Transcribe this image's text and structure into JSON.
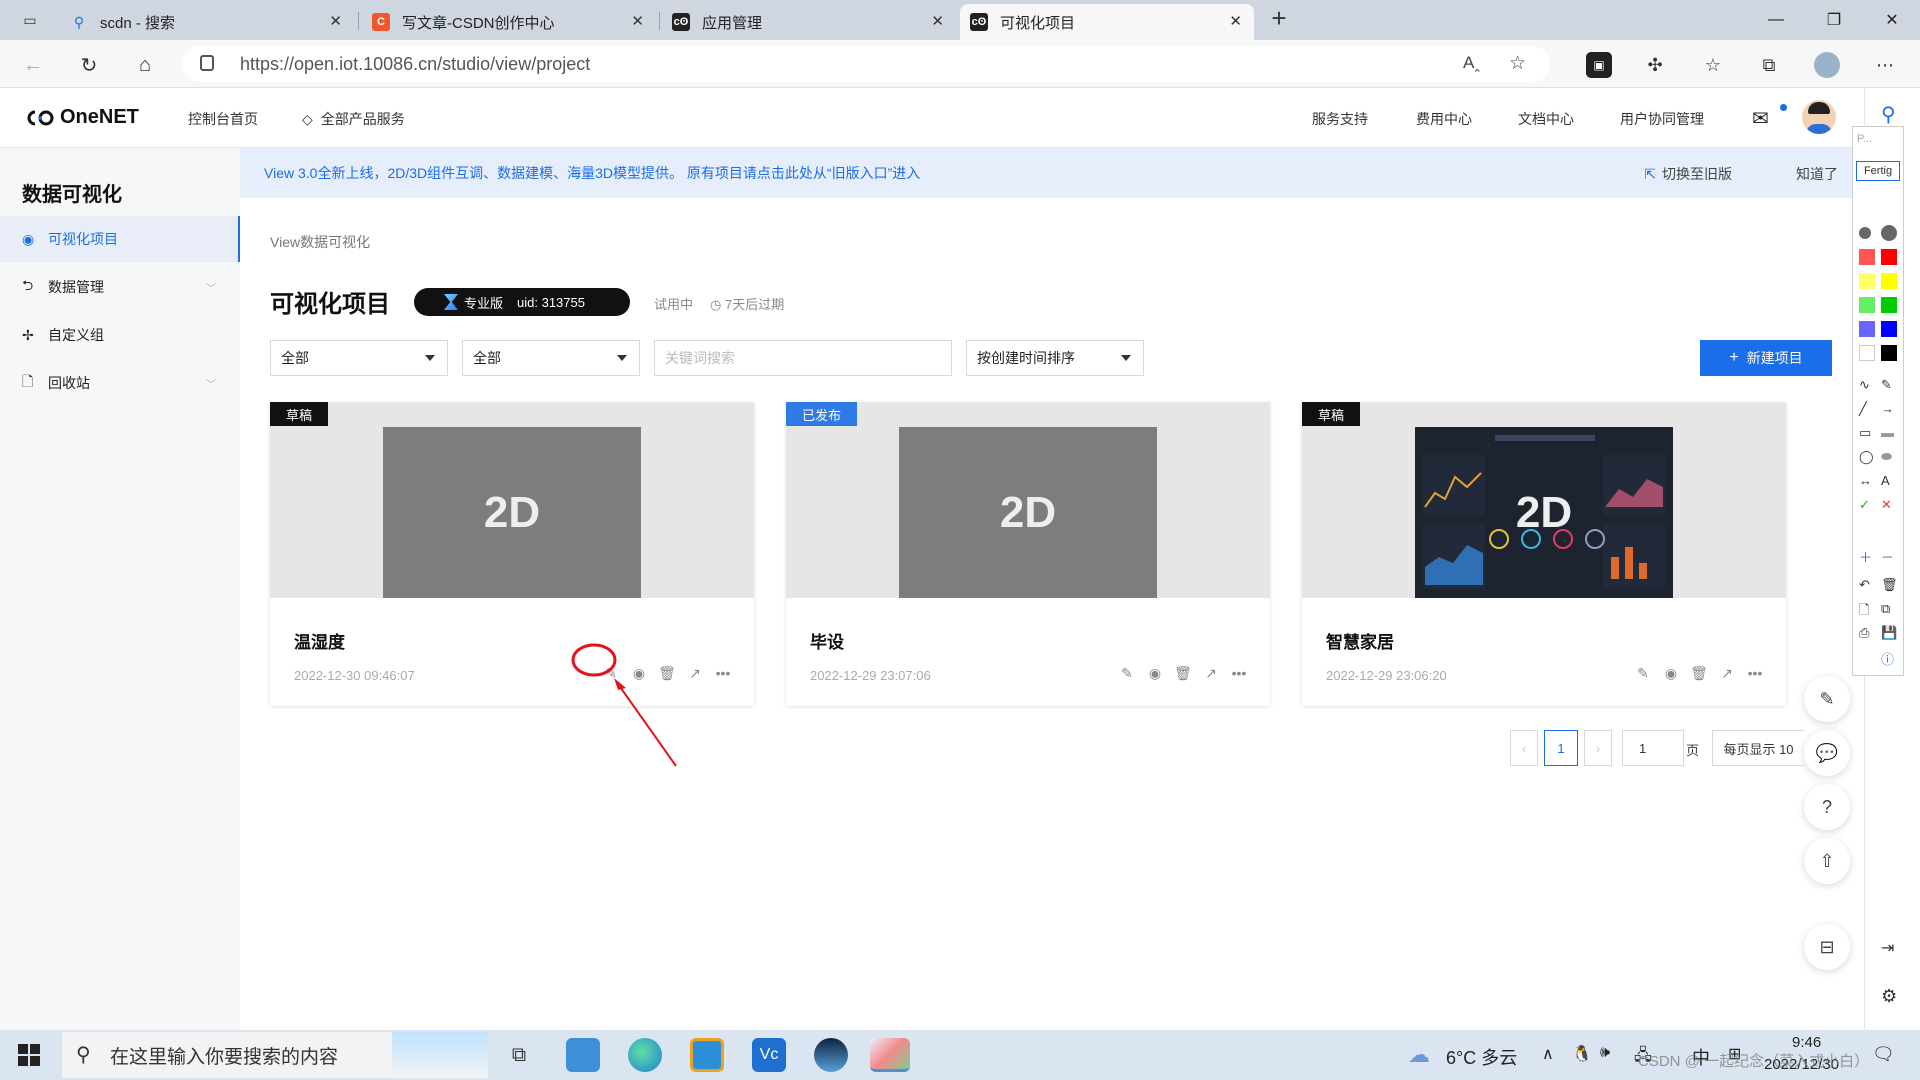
{
  "browser": {
    "tabs": [
      {
        "title": "scdn - 搜索",
        "icon": "search-icon"
      },
      {
        "title": "写文章-CSDN创作中心",
        "icon": "csdn-icon"
      },
      {
        "title": "应用管理",
        "icon": "onenet-icon"
      },
      {
        "title": "可视化项目",
        "icon": "onenet-icon"
      }
    ],
    "url": "https://open.iot.10086.cn/studio/view/project"
  },
  "header": {
    "logo": "OneNET",
    "nav_console": "控制台首页",
    "nav_products": "全部产品服务",
    "nav_support": "服务支持",
    "nav_billing": "费用中心",
    "nav_docs": "文档中心",
    "nav_users": "用户协同管理"
  },
  "sidebar": {
    "title": "数据可视化",
    "items": [
      {
        "label": "可视化项目",
        "icon": "dashboard-icon"
      },
      {
        "label": "数据管理",
        "icon": "data-icon"
      },
      {
        "label": "自定义组",
        "icon": "group-icon"
      },
      {
        "label": "回收站",
        "icon": "trash-icon"
      }
    ]
  },
  "notice": {
    "text": "View 3.0全新上线，2D/3D组件互调、数据建模、海量3D模型提供。 原有项目请点击此处从“旧版入口”进入",
    "switch_label": "切换至旧版",
    "dismiss_label": "知道了"
  },
  "main": {
    "breadcrumb": "View数据可视化",
    "title": "可视化项目",
    "edition": "专业版",
    "uid": "uid: 313755",
    "trial": "试用中",
    "expire": "7天后过期",
    "filter1": "全部",
    "filter2": "全部",
    "search_placeholder": "关键词搜索",
    "sort": "按创建时间排序",
    "new_button": "新建项目"
  },
  "cards": [
    {
      "name": "温湿度",
      "time": "2022-12-30 09:46:07",
      "badge": "草稿",
      "badge_color": "#111111",
      "preview": "2D"
    },
    {
      "name": "毕设",
      "time": "2022-12-29 23:07:06",
      "badge": "已发布",
      "badge_color": "#2f7ae5",
      "preview": "2D"
    },
    {
      "name": "智慧家居",
      "time": "2022-12-29 23:06:20",
      "badge": "草稿",
      "badge_color": "#111111",
      "preview": "2D"
    }
  ],
  "pagination": {
    "current": "1",
    "jump_value": "1",
    "page_label": "页",
    "per_page": "每页显示 10"
  },
  "annotation_toolbar": {
    "button": "Fertig",
    "top_label": "P..."
  },
  "taskbar": {
    "search_placeholder": "在这里输入你要搜索的内容",
    "weather": "6°C 多云",
    "ime": "中",
    "time": "9:46",
    "date": "2022/12/30",
    "watermark": "CSDN @ 一起纪念（菜入式小白）"
  },
  "colors": {
    "accent": "#1a6fe8",
    "draft_badge": "#111111",
    "published_badge": "#2f7ae5",
    "annotation_red": "#e3121b"
  }
}
